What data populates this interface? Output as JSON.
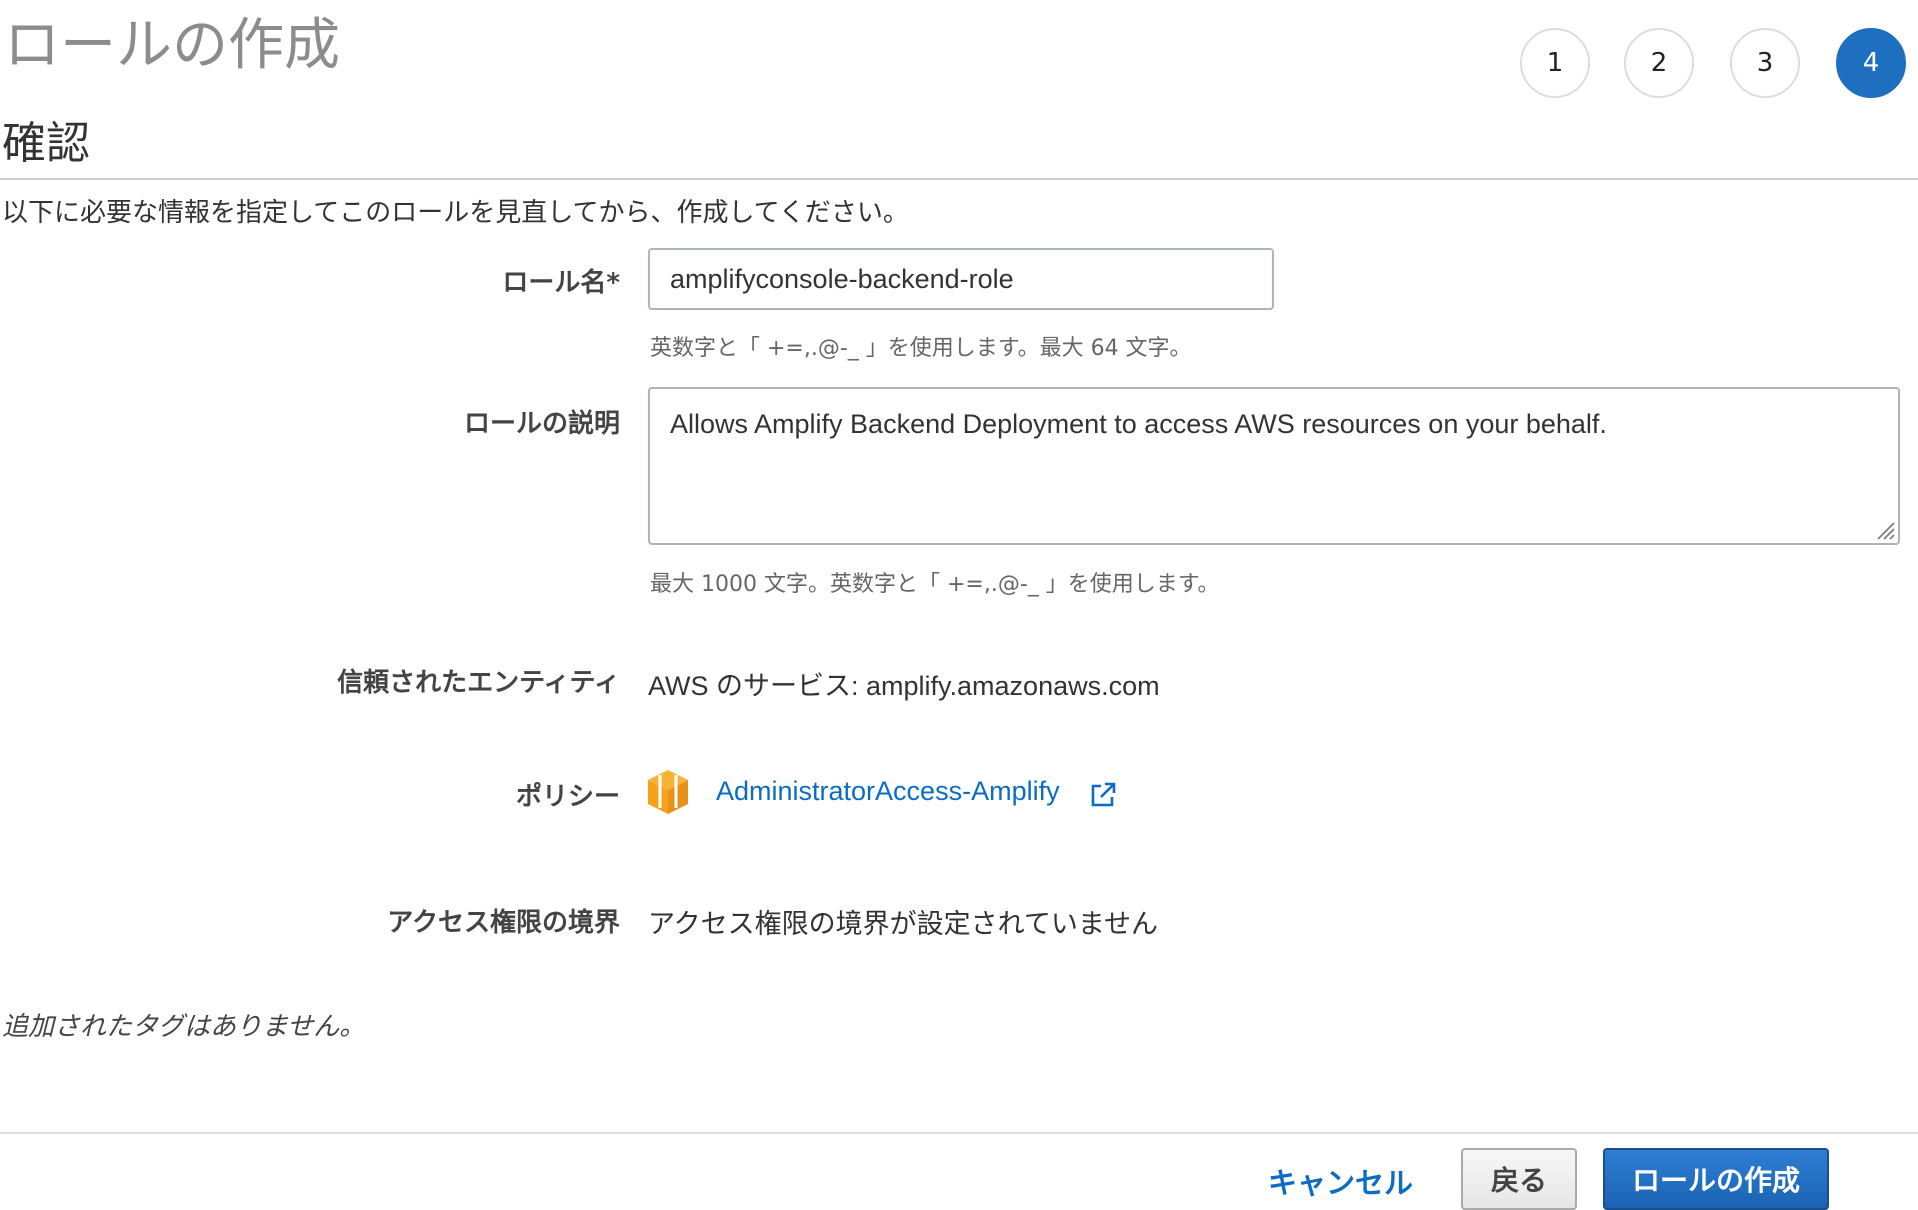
{
  "header": {
    "title": "ロールの作成",
    "steps": [
      "1",
      "2",
      "3",
      "4"
    ],
    "active_step": "4"
  },
  "section": {
    "title": "確認",
    "instructions": "以下に必要な情報を指定してこのロールを見直してから、作成してください。"
  },
  "role_name": {
    "label": "ロール名*",
    "value": "amplifyconsole-backend-role",
    "hint": "英数字と「 +=,.@-_ 」を使用します。最大 64 文字。"
  },
  "role_description": {
    "label": "ロールの説明",
    "value": "Allows Amplify Backend Deployment to access AWS resources on your behalf.",
    "hint": "最大 1000 文字。英数字と「 +=,.@-_ 」を使用します。"
  },
  "trusted_entity": {
    "label": "信頼されたエンティティ",
    "value": "AWS のサービス: amplify.amazonaws.com"
  },
  "policy": {
    "label": "ポリシー",
    "icon": "aws-managed-policy-box-icon",
    "link_text": "AdministratorAccess-Amplify",
    "link_icon": "external-link-icon"
  },
  "permissions_boundary": {
    "label": "アクセス権限の境界",
    "value": "アクセス権限の境界が設定されていません"
  },
  "tags": {
    "message": "追加されたタグはありません。"
  },
  "footer": {
    "cancel_label": "キャンセル",
    "back_label": "戻る",
    "create_label": "ロールの作成"
  },
  "colors": {
    "primary": "#1f6fc1",
    "link": "#0b6cc4",
    "policy_icon": "#f7a21b"
  }
}
